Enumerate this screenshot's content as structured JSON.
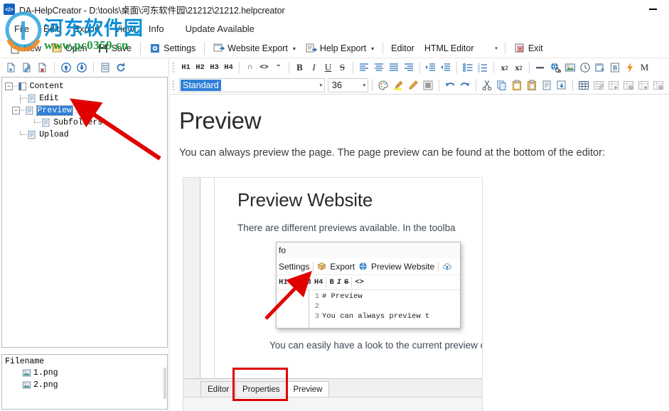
{
  "window": {
    "title": "DA-HelpCreator - D:\\tools\\桌面\\河东软件园\\21212\\21212.helpcreator",
    "app_icon": "code-tags-icon",
    "minimize_label": "—"
  },
  "menubar": {
    "items": [
      {
        "label": "File",
        "name": "menu-file"
      },
      {
        "label": "Edit",
        "name": "menu-edit"
      },
      {
        "label": "Export",
        "name": "menu-export"
      },
      {
        "label": "View",
        "name": "menu-view"
      },
      {
        "label": "Info",
        "name": "menu-info"
      },
      {
        "label": "Update Available",
        "name": "menu-update-available"
      }
    ]
  },
  "toolbar": {
    "new_label": "New",
    "open_label": "Open",
    "save_label": "Save",
    "settings_label": "Settings",
    "website_export_label": "Website Export",
    "help_export_label": "Help Export",
    "editor_label": "Editor",
    "editor_value": "HTML Editor",
    "exit_label": "Exit",
    "caret": "▾"
  },
  "tree_toolbar": {
    "buttons": [
      {
        "name": "new-page-icon",
        "title": "New Page"
      },
      {
        "name": "edit-page-icon",
        "title": "Edit Page"
      },
      {
        "name": "delete-page-icon",
        "title": "Delete Page"
      },
      {
        "name": "move-up-icon",
        "title": "Move Up"
      },
      {
        "name": "move-down-icon",
        "title": "Move Down"
      },
      {
        "name": "page-properties-icon",
        "title": "Properties"
      },
      {
        "name": "refresh-icon",
        "title": "Refresh"
      }
    ]
  },
  "format_toolbar": {
    "headings": [
      "H1",
      "H2",
      "H3",
      "H4"
    ],
    "quote_glyph": "∩",
    "code_glyph": "<>",
    "blockquote_glyph": "❝",
    "bold": "B",
    "italic": "I",
    "underline": "U",
    "strike": "S",
    "superscript": "x²",
    "subscript": "x₂",
    "align_left": "align-left-icon",
    "align_center": "align-center-icon",
    "align_justify": "align-justify-icon",
    "align_right": "align-right-icon",
    "indent_increase": "indent-increase-icon",
    "indent_decrease": "indent-decrease-icon",
    "bullet_list": "bullet-list-icon",
    "numbered_list": "numbered-list-icon",
    "horizontal_rule": "horizontal-rule-icon",
    "link": "link-globe-icon",
    "image": "insert-image-icon",
    "clock": "insert-time-icon",
    "insert_box": "insert-box-icon",
    "bookmark": "bookmark-b-icon",
    "lightning": "lightning-icon",
    "more": "M"
  },
  "style_toolbar": {
    "style_value": "Standard",
    "font_size": "36",
    "arrow": "▾",
    "buttons": [
      {
        "name": "color-palette-icon"
      },
      {
        "name": "highlighter-icon"
      },
      {
        "name": "marker-pen-icon"
      },
      {
        "name": "fill-color-icon"
      },
      {
        "name": "undo-icon"
      },
      {
        "name": "redo-icon"
      },
      {
        "name": "cut-icon"
      },
      {
        "name": "copy-icon"
      },
      {
        "name": "paste-icon"
      },
      {
        "name": "paste-plain-icon"
      },
      {
        "name": "paste-format-icon"
      },
      {
        "name": "import-icon"
      },
      {
        "name": "insert-table-icon"
      },
      {
        "name": "edit-table-icon"
      },
      {
        "name": "add-row-icon"
      },
      {
        "name": "delete-row-icon"
      },
      {
        "name": "add-column-icon"
      },
      {
        "name": "delete-column-icon"
      }
    ]
  },
  "tree": {
    "nodes": [
      {
        "label": "Content",
        "level": 0,
        "expander": "−",
        "icon": "content-root-icon",
        "selected": false
      },
      {
        "label": "Edit",
        "level": 1,
        "expander": "",
        "icon": "page-icon",
        "selected": false
      },
      {
        "label": "Preview",
        "level": 1,
        "expander": "−",
        "icon": "page-icon",
        "selected": true
      },
      {
        "label": "Subfolders",
        "level": 2,
        "expander": "",
        "icon": "page-icon",
        "selected": false
      },
      {
        "label": "Upload",
        "level": 1,
        "expander": "",
        "icon": "page-icon",
        "selected": false
      }
    ]
  },
  "file_panel": {
    "header": "Filename",
    "files": [
      {
        "name": "1.png",
        "icon": "image-file-icon"
      },
      {
        "name": "2.png",
        "icon": "image-file-icon"
      }
    ]
  },
  "document": {
    "heading": "Preview",
    "paragraph": "You can always preview the page. The page preview can be found at the bottom of the editor:"
  },
  "screenshot": {
    "heading": "Preview Website",
    "paragraph": "There are different previews available. In the toolba",
    "paragraph2": "You can easily have a look to the current preview o",
    "inner": {
      "menu_partial": "fo",
      "settings_label": "Settings",
      "export_label": "Export",
      "preview_website_label": "Preview Website",
      "upload_icon": "cloud-upload-icon",
      "headings": [
        "H1",
        "H2",
        "H3",
        "H4"
      ],
      "bold": "B",
      "italic": "I",
      "strike": "S",
      "code": "<>",
      "code_lines": [
        {
          "num": "1",
          "text": "# Preview"
        },
        {
          "num": "2",
          "text": ""
        },
        {
          "num": "3",
          "text": "You can always preview t"
        }
      ]
    },
    "tabs": [
      {
        "label": "Editor",
        "active": false
      },
      {
        "label": "Properties",
        "active": false
      },
      {
        "label": "Preview",
        "active": true
      }
    ]
  },
  "watermark": {
    "chinese": "河东软件园",
    "url": "www.pc0359.cn"
  },
  "colors": {
    "accent_blue": "#2f7fd8",
    "annotation_red": "#e00000",
    "watermark_blue": "#0b8fd4",
    "watermark_green": "#1f9a3f",
    "toolbar_icon_blue": "#2c6fb5"
  }
}
